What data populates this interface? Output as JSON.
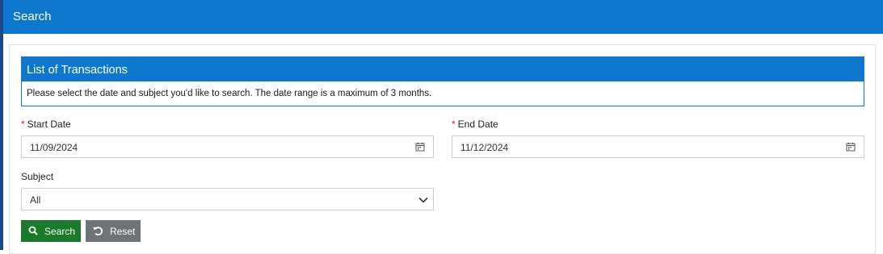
{
  "header": {
    "title": "Search"
  },
  "panel": {
    "title": "List of Transactions",
    "message": "Please select the date and subject you'd like to search. The date range is a maximum of 3 months."
  },
  "form": {
    "start_date": {
      "required_mark": "*",
      "label": "Start Date",
      "value": "11/09/2024",
      "icon": "calendar-icon"
    },
    "end_date": {
      "required_mark": "*",
      "label": "End Date",
      "value": "11/12/2024",
      "icon": "calendar-icon"
    },
    "subject": {
      "label": "Subject",
      "value": "All",
      "icon": "chevron-down-icon"
    }
  },
  "buttons": {
    "search": {
      "label": "Search",
      "icon": "search-icon",
      "color": "#187a2a"
    },
    "reset": {
      "label": "Reset",
      "icon": "undo-icon",
      "color": "#6e7378"
    }
  },
  "colors": {
    "accent": "#0e78cf",
    "required": "#d9261c"
  }
}
